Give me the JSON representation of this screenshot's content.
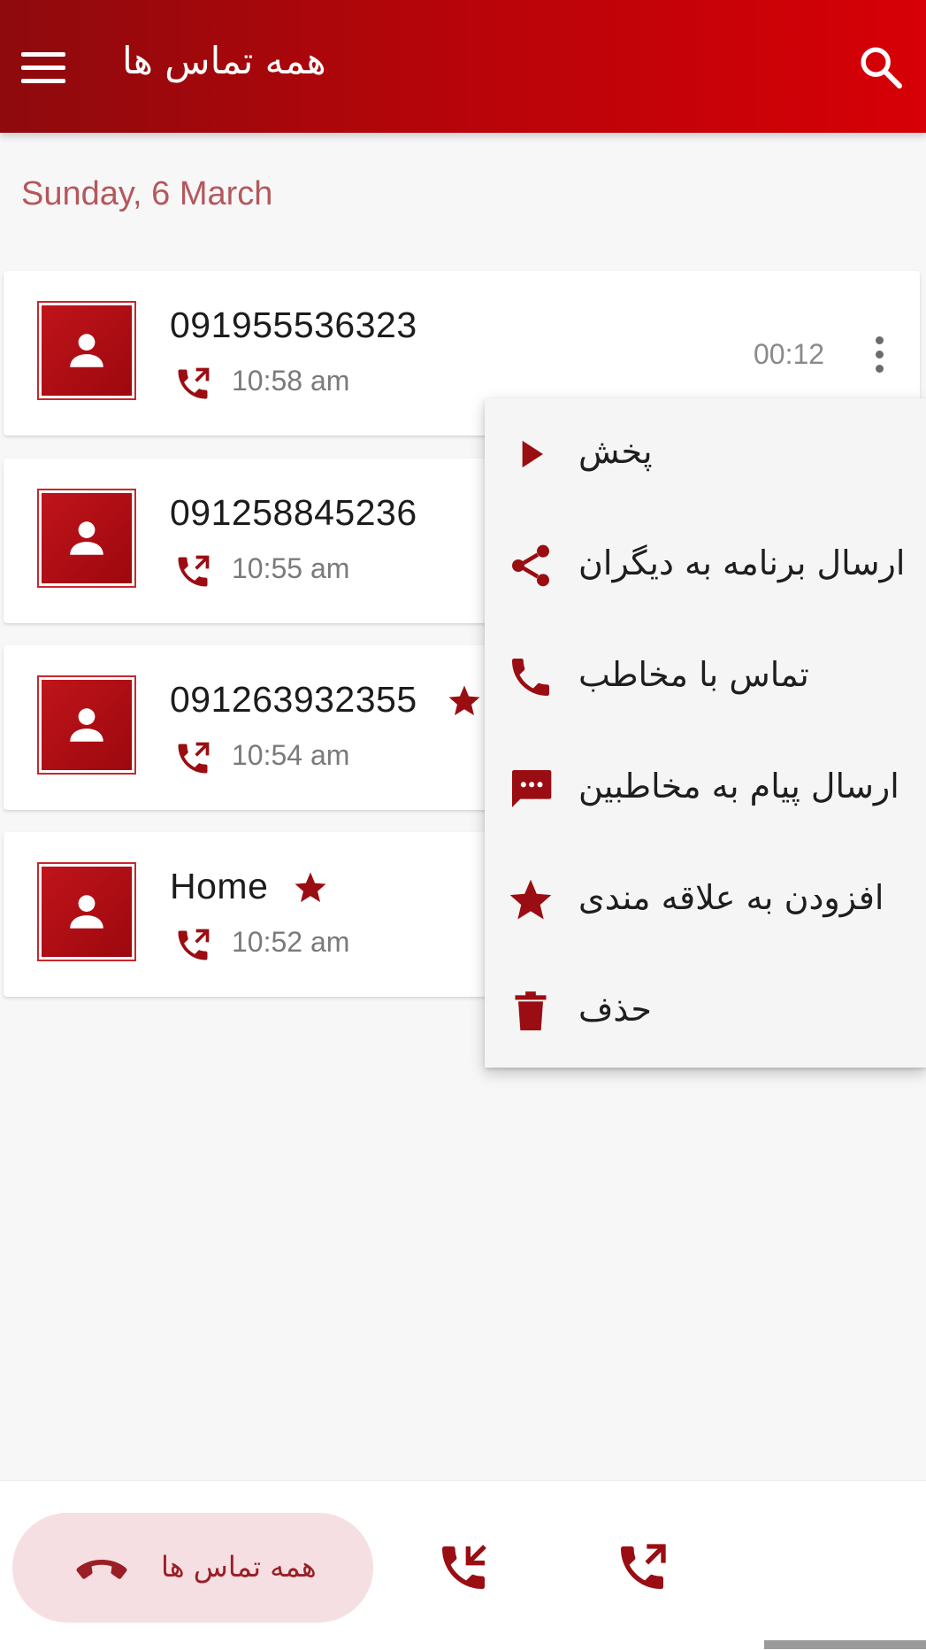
{
  "app_bar": {
    "title": "همه تماس ها",
    "menu_icon": "hamburger-menu-icon",
    "search_icon": "search-icon",
    "colors": {
      "start": "#8e0a0d",
      "end": "#d60006"
    }
  },
  "date_header": "Sunday, 6 March",
  "calls": [
    {
      "number": "091955536323",
      "time": "10:58 am",
      "duration": "00:12",
      "starred": false,
      "type_icon": "outgoing-call-icon"
    },
    {
      "number": "091258845236",
      "time": "10:55 am",
      "starred": false,
      "type_icon": "outgoing-call-icon"
    },
    {
      "number": "091263932355",
      "time": "10:54 am",
      "starred": true,
      "type_icon": "outgoing-call-icon"
    },
    {
      "number": "Home",
      "time": "10:52 am",
      "starred": true,
      "type_icon": "outgoing-call-icon"
    }
  ],
  "context_menu": {
    "items": [
      {
        "label": "پخش",
        "icon": "play-icon"
      },
      {
        "label": "ارسال برنامه به دیگران",
        "icon": "share-icon"
      },
      {
        "label": "تماس با مخاطب",
        "icon": "phone-icon"
      },
      {
        "label": "ارسال پیام به مخاطبین",
        "icon": "message-icon"
      },
      {
        "label": "افزودن به علاقه مندی",
        "icon": "star-icon"
      },
      {
        "label": "حذف",
        "icon": "trash-icon"
      }
    ]
  },
  "bottom_nav": {
    "all_calls_label": "همه تماس ها",
    "all_calls_icon": "hang-up-phone-icon",
    "incoming_icon": "incoming-call-icon",
    "outgoing_icon": "outgoing-call-icon"
  },
  "accent_color": "#9a0d12"
}
